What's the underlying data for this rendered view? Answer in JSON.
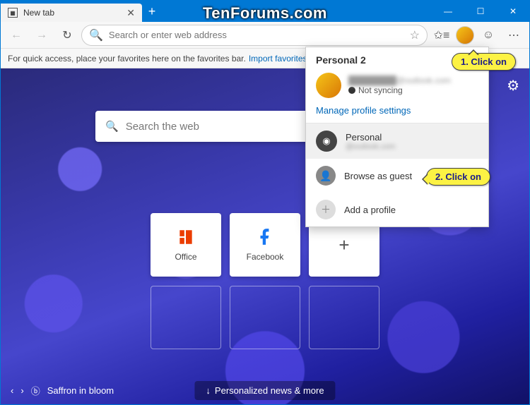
{
  "window": {
    "tab_title": "New tab",
    "minimize": "—",
    "maximize": "☐",
    "close": "✕"
  },
  "toolbar": {
    "search_placeholder": "Search or enter web address"
  },
  "favbar": {
    "text": "For quick access, place your favorites here on the favorites bar.",
    "link": "Import favorites"
  },
  "ntp": {
    "search_placeholder": "Search the web",
    "tiles": [
      {
        "label": "Office"
      },
      {
        "label": "Facebook"
      }
    ],
    "add_tile": "+"
  },
  "footer": {
    "caption": "Saffron in bloom",
    "news": "Personalized news & more"
  },
  "flyout": {
    "title": "Personal 2",
    "email_masked": "████████@outlook.com",
    "sync_status": "Not syncing",
    "manage": "Manage profile settings",
    "other_profile": {
      "name": "Personal",
      "email": "@outlook.com"
    },
    "guest": "Browse as guest",
    "add": "Add a profile"
  },
  "callouts": {
    "c1": "1. Click on",
    "c2": "2. Click on"
  },
  "watermark": "TenForums.com"
}
